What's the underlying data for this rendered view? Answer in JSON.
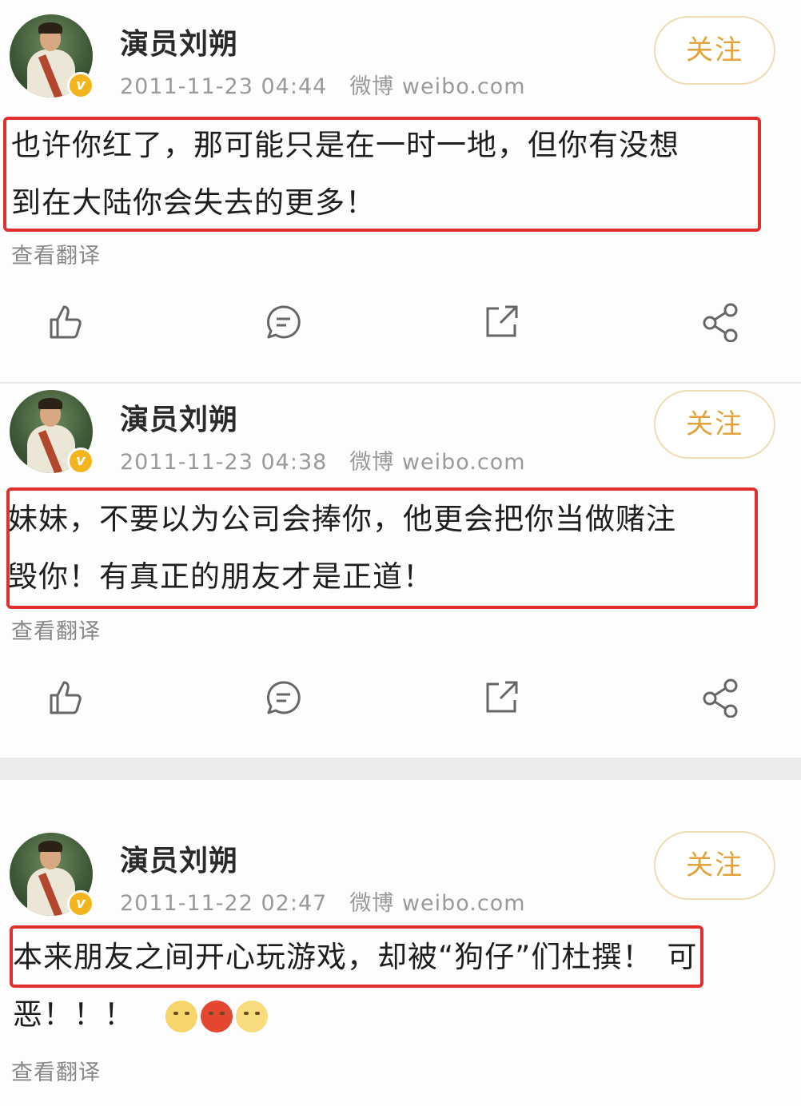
{
  "posts": [
    {
      "author": "演员刘朔",
      "timestamp": "2011-11-23 04:44",
      "source": "微博 weibo.com",
      "follow_label": "关注",
      "line1": "也许你红了，那可能只是在一时一地，但你有没想",
      "line2": "到在大陆你会失去的更多！",
      "translate_label": "查看翻译"
    },
    {
      "author": "演员刘朔",
      "timestamp": "2011-11-23 04:38",
      "source": "微博 weibo.com",
      "follow_label": "关注",
      "line1": "妹妹，不要以为公司会捧你，他更会把你当做赌注",
      "line2": "毁你！有真正的朋友才是正道！",
      "translate_label": "查看翻译"
    },
    {
      "author": "演员刘朔",
      "timestamp": "2011-11-22 02:47",
      "source": "微博 weibo.com",
      "follow_label": "关注",
      "line1_boxed": "本来朋友之间开心玩游戏，却被“狗仔”们杜撰！",
      "line1_tail": "可",
      "line2": "恶！！！",
      "translate_label": "查看翻译"
    }
  ],
  "icons": {
    "like": "thumbs-up-icon",
    "comment": "comment-icon",
    "repost": "repost-icon",
    "share": "share-icon",
    "verified": "verified-badge-icon"
  },
  "colors": {
    "highlight": "#e0302e",
    "follow_text": "#e4a33a",
    "verified": "#f4b51c"
  },
  "verified_mark": "v"
}
